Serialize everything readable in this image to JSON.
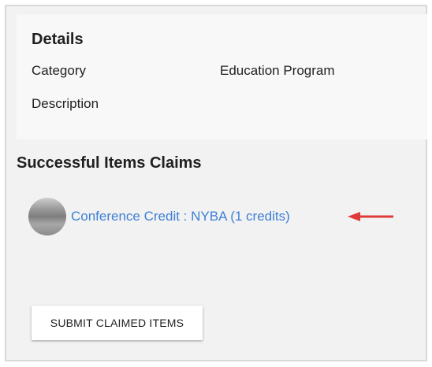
{
  "details": {
    "title": "Details",
    "category_label": "Category",
    "category_value": "Education Program",
    "description_label": "Description"
  },
  "claims": {
    "section_title": "Successful Items Claims",
    "items": [
      {
        "label": "Conference Credit : NYBA (1 credits)"
      }
    ]
  },
  "actions": {
    "submit_label": "SUBMIT CLAIMED ITEMS"
  },
  "annotation": {
    "arrow_color": "#e03a3a",
    "arrow_icon": "left-arrow-icon"
  },
  "colors": {
    "link": "#3d7fd6",
    "panel_background": "#f2f2f2",
    "card_background": "#f8f8f8"
  }
}
